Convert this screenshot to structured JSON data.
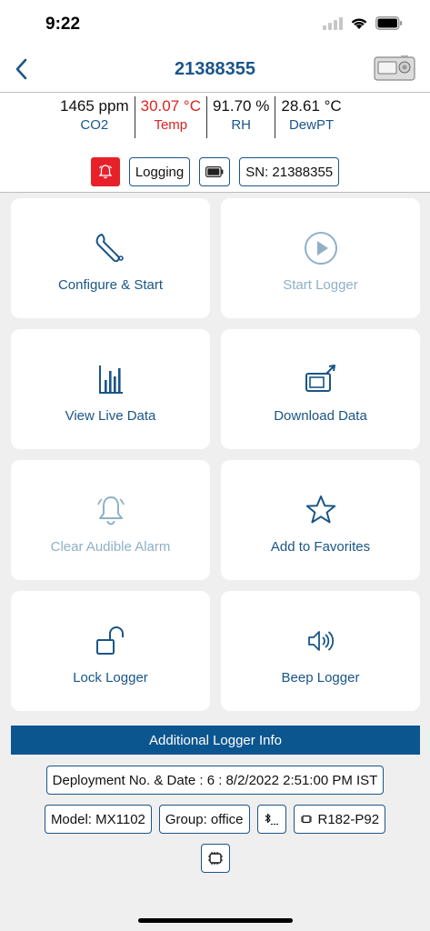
{
  "status_bar": {
    "time": "9:22"
  },
  "header": {
    "title": "21388355"
  },
  "readings": [
    {
      "value": "1465 ppm",
      "label": "CO2",
      "alert": false
    },
    {
      "value": "30.07 °C",
      "label": "Temp",
      "alert": true
    },
    {
      "value": "91.70 %",
      "label": "RH",
      "alert": false
    },
    {
      "value": "28.61 °C",
      "label": "DewPT",
      "alert": false
    }
  ],
  "chips": {
    "logging": "Logging",
    "serial": "SN: 21388355"
  },
  "actions": [
    {
      "label": "Configure & Start",
      "icon": "wrench-icon",
      "enabled": true
    },
    {
      "label": "Start Logger",
      "icon": "play-icon",
      "enabled": false
    },
    {
      "label": "View Live Data",
      "icon": "bar-chart-icon",
      "enabled": true
    },
    {
      "label": "Download Data",
      "icon": "download-device-icon",
      "enabled": true
    },
    {
      "label": "Clear Audible Alarm",
      "icon": "bell-icon",
      "enabled": false
    },
    {
      "label": "Add to Favorites",
      "icon": "star-icon",
      "enabled": true
    },
    {
      "label": "Lock Logger",
      "icon": "unlock-icon",
      "enabled": true
    },
    {
      "label": "Beep Logger",
      "icon": "speaker-icon",
      "enabled": true
    }
  ],
  "info": {
    "heading": "Additional Logger Info",
    "deployment": "Deployment No. & Date : 6 : 8/2/2022 2:51:00 PM IST",
    "model": "Model: MX1102",
    "group": "Group: office",
    "firmware": "R182-P92"
  },
  "colors": {
    "accent": "#1a5588",
    "alarm": "#e6212a",
    "info_bar": "#0c5690",
    "disabled": "#8fb0c8"
  }
}
